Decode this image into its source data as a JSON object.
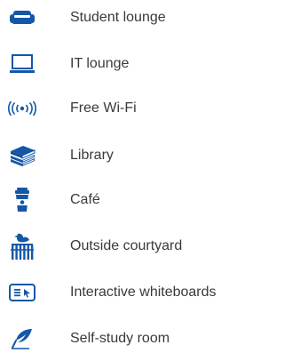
{
  "accent_color": "#1457a8",
  "amenities": [
    {
      "label": "Student lounge",
      "icon": "sofa-icon"
    },
    {
      "label": "IT lounge",
      "icon": "laptop-icon"
    },
    {
      "label": "Free Wi-Fi",
      "icon": "wifi-icon"
    },
    {
      "label": "Library",
      "icon": "books-icon"
    },
    {
      "label": "Café",
      "icon": "coffee-cup-icon"
    },
    {
      "label": "Outside courtyard",
      "icon": "bird-fence-icon"
    },
    {
      "label": "Interactive whiteboards",
      "icon": "whiteboard-icon"
    },
    {
      "label": "Self-study room",
      "icon": "quill-pen-icon"
    }
  ]
}
